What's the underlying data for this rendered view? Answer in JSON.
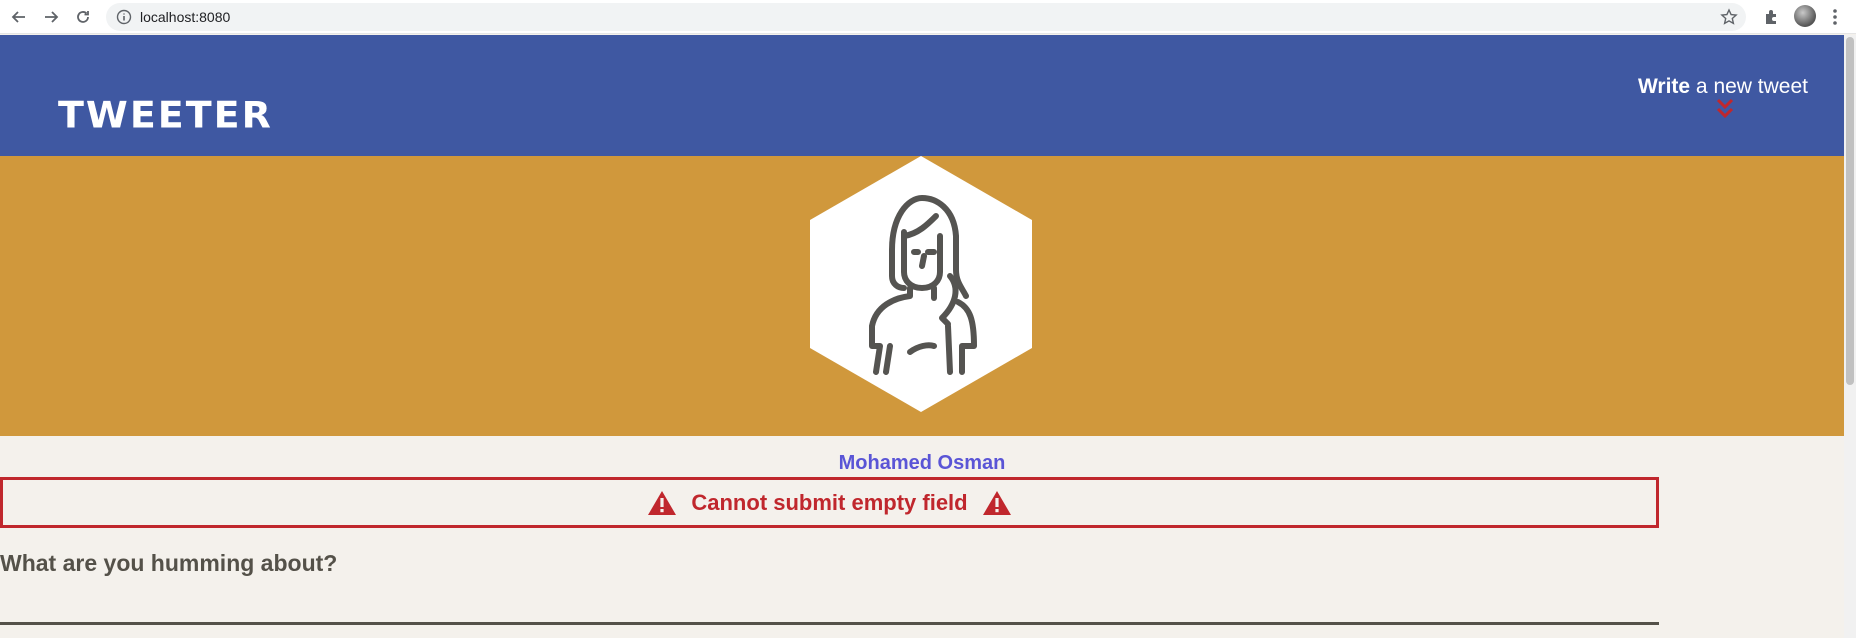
{
  "browser": {
    "url": "localhost:8080"
  },
  "header": {
    "logo": "TWEETER",
    "compose_strong": "Write",
    "compose_light": " a new tweet"
  },
  "profile": {
    "name": "Mohamed Osman"
  },
  "error": {
    "message": "Cannot submit empty field"
  },
  "compose_form": {
    "prompt": "What are you humming about?"
  },
  "colors": {
    "header": "#3f58a2",
    "banner": "#d0983c",
    "background": "#f4f1ec",
    "error": "#c0272d",
    "username": "#5a55d6"
  }
}
